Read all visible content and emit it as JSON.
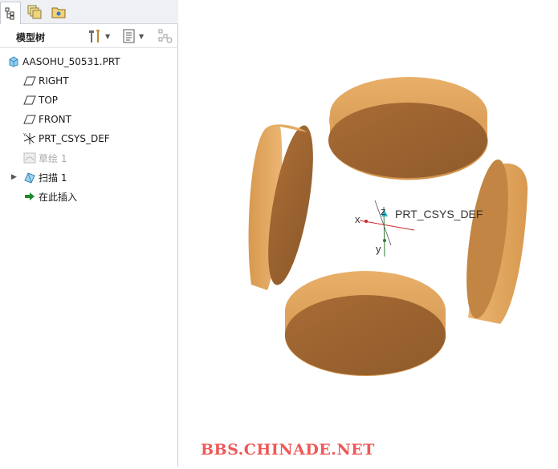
{
  "colors": {
    "wood_light": "#e3a860",
    "wood_mid": "#c98a47",
    "wood_dark": "#9c6430",
    "watermark": "#f05858",
    "panel_border": "#c9cdd2"
  },
  "tabs": [
    {
      "icon": "model-tree-icon",
      "active": true
    },
    {
      "icon": "layers-icon",
      "active": false
    },
    {
      "icon": "folder-browser-icon",
      "active": false
    }
  ],
  "toolbar": {
    "title": "模型树",
    "settings_icon": "tools-icon",
    "show_icon": "list-icon",
    "filter_icon": "tree-filter-icon"
  },
  "tree": {
    "items": [
      {
        "label": "AASOHU_50531.PRT",
        "icon": "part-icon"
      },
      {
        "label": "RIGHT",
        "icon": "datum-plane-icon"
      },
      {
        "label": "TOP",
        "icon": "datum-plane-icon"
      },
      {
        "label": "FRONT",
        "icon": "datum-plane-icon"
      },
      {
        "label": "PRT_CSYS_DEF",
        "icon": "coordinate-system-icon"
      },
      {
        "label": "草绘 1",
        "icon": "sketch-icon"
      },
      {
        "label": "扫描 1",
        "icon": "sweep-icon"
      },
      {
        "label": "在此插入",
        "icon": "insert-here-arrow-icon"
      }
    ]
  },
  "viewport": {
    "csys_label": "PRT_CSYS_DEF",
    "axis_x": "x",
    "axis_y": "y",
    "axis_z": "z"
  },
  "watermark": "BBS.CHINADE.NET"
}
